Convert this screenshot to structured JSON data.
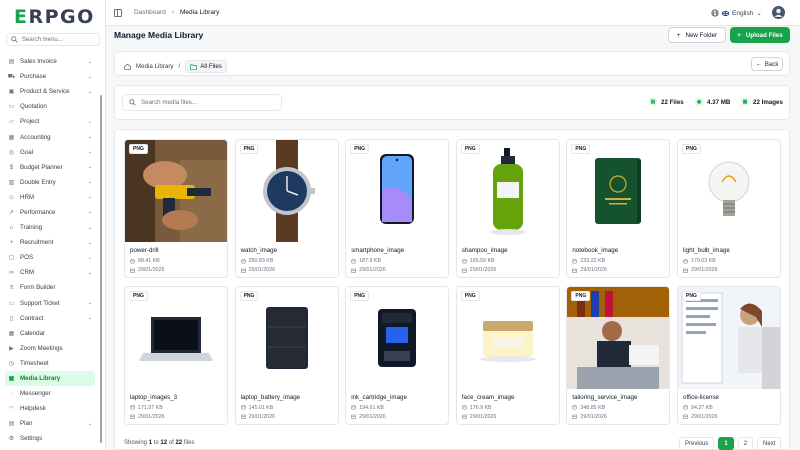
{
  "app": {
    "logo_first": "E",
    "logo_rest": "RPGO"
  },
  "sidebar": {
    "search_placeholder": "Search menu...",
    "items": [
      {
        "label": "Sales Invoice",
        "icon": "invoice-icon",
        "chevron": true
      },
      {
        "label": "Purchase",
        "icon": "cart-icon",
        "chevron": true
      },
      {
        "label": "Product & Service",
        "icon": "box-icon",
        "chevron": true
      },
      {
        "label": "Quotation",
        "icon": "document-icon",
        "chevron": false
      },
      {
        "label": "Project",
        "icon": "folder-icon",
        "chevron": true
      },
      {
        "label": "Accounting",
        "icon": "calculator-icon",
        "chevron": true
      },
      {
        "label": "Goal",
        "icon": "target-icon",
        "chevron": true
      },
      {
        "label": "Budget Planner",
        "icon": "piggy-bank-icon",
        "chevron": true
      },
      {
        "label": "Double Entry",
        "icon": "book-icon",
        "chevron": true
      },
      {
        "label": "HRM",
        "icon": "users-icon",
        "chevron": true
      },
      {
        "label": "Performance",
        "icon": "trend-icon",
        "chevron": true
      },
      {
        "label": "Training",
        "icon": "graduation-icon",
        "chevron": true
      },
      {
        "label": "Recruitment",
        "icon": "user-plus-icon",
        "chevron": true
      },
      {
        "label": "POS",
        "icon": "pos-icon",
        "chevron": true
      },
      {
        "label": "CRM",
        "icon": "handshake-icon",
        "chevron": true
      },
      {
        "label": "Form Builder",
        "icon": "form-icon",
        "chevron": false
      },
      {
        "label": "Support Ticket",
        "icon": "ticket-icon",
        "chevron": true
      },
      {
        "label": "Contract",
        "icon": "contract-icon",
        "chevron": true
      },
      {
        "label": "Calendar",
        "icon": "calendar-icon",
        "chevron": false
      },
      {
        "label": "Zoom Meetings",
        "icon": "video-icon",
        "chevron": false
      },
      {
        "label": "Timesheet",
        "icon": "clock-icon",
        "chevron": false
      },
      {
        "label": "Media Library",
        "icon": "image-icon",
        "chevron": false,
        "active": true
      },
      {
        "label": "Messenger",
        "icon": "chat-icon",
        "chevron": false
      },
      {
        "label": "Helpdesk",
        "icon": "headset-icon",
        "chevron": false
      },
      {
        "label": "Plan",
        "icon": "plan-icon",
        "chevron": true
      },
      {
        "label": "Settings",
        "icon": "gear-icon",
        "chevron": false
      }
    ]
  },
  "topbar": {
    "breadcrumb": [
      "Dashboard",
      "Media Library"
    ],
    "language": "English"
  },
  "header": {
    "title": "Manage Media Library",
    "new_folder": "New Folder",
    "upload": "Upload Files"
  },
  "folder_bar": {
    "root": "Media Library",
    "current": "All Files",
    "back": "Back"
  },
  "search": {
    "placeholder": "Search media files...",
    "stats": {
      "files": "22 Files",
      "size": "4.37 MB",
      "images": "22 Images"
    }
  },
  "files": [
    {
      "name": "power-drill",
      "size": "88.41 KB",
      "date": "29/01/2026",
      "type": "PNG",
      "thumb": "drill"
    },
    {
      "name": "watch_image",
      "size": "250.83 KB",
      "date": "29/01/2026",
      "type": "PNG",
      "thumb": "watch"
    },
    {
      "name": "smartphone_image",
      "size": "187.9 KB",
      "date": "29/01/2026",
      "type": "PNG",
      "thumb": "phone"
    },
    {
      "name": "shampoo_image",
      "size": "165.59 KB",
      "date": "29/01/2026",
      "type": "PNG",
      "thumb": "shampoo"
    },
    {
      "name": "notebook_image",
      "size": "233.22 KB",
      "date": "29/01/2026",
      "type": "PNG",
      "thumb": "notebook"
    },
    {
      "name": "light_bulb_image",
      "size": "179.03 KB",
      "date": "29/01/2026",
      "type": "PNG",
      "thumb": "bulb"
    },
    {
      "name": "laptop_images_3",
      "size": "171.97 KB",
      "date": "29/01/2026",
      "type": "PNG",
      "thumb": "laptop"
    },
    {
      "name": "laptop_battery_image",
      "size": "145.01 KB",
      "date": "29/01/2026",
      "type": "PNG",
      "thumb": "battery"
    },
    {
      "name": "ink_cartridge_image",
      "size": "194.61 KB",
      "date": "29/01/2026",
      "type": "PNG",
      "thumb": "ink"
    },
    {
      "name": "face_cream_image",
      "size": "176.9 KB",
      "date": "29/01/2026",
      "type": "PNG",
      "thumb": "cream"
    },
    {
      "name": "tailoring_service_image",
      "size": "348.85 KB",
      "date": "29/01/2026",
      "type": "PNG",
      "thumb": "tailor"
    },
    {
      "name": "office-license",
      "size": "94.27 KB",
      "date": "29/01/2026",
      "type": "PNG",
      "thumb": "office"
    }
  ],
  "footer": {
    "showing_prefix": "Showing",
    "from": "1",
    "to_word": "to",
    "to": "12",
    "of_word": "of",
    "total": "22",
    "suffix": "files",
    "pages": [
      "Previous",
      "1",
      "2",
      "Next"
    ]
  },
  "colors": {
    "accent": "#16a34a",
    "accent_light": "#dcfce7"
  }
}
